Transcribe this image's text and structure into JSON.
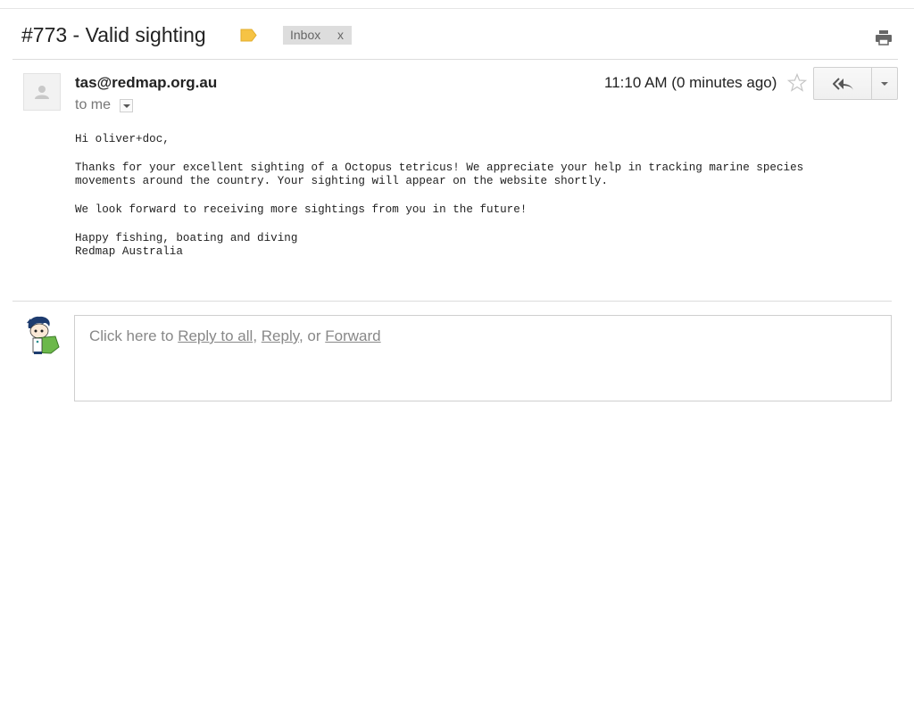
{
  "thread": {
    "subject": "#773 - Valid sighting",
    "label_icon": "label-tag-icon",
    "label_color": "#f6c344",
    "inbox_chip": {
      "label": "Inbox",
      "remove": "x"
    },
    "print_icon": "print-icon"
  },
  "message": {
    "sender": "tas@redmap.org.au",
    "recipient_label": "to me",
    "timestamp": "11:10 AM (0 minutes ago)",
    "star_icon": "star-outline-icon",
    "reply_icon": "reply-all-icon",
    "more_icon": "chevron-down-icon",
    "body": [
      "Hi oliver+doc,",
      "Thanks for your excellent sighting of a Octopus tetricus! We appreciate your help in tracking marine species\nmovements around the country. Your sighting will appear on the website shortly.",
      "We look forward to receiving more sightings from you in the future!",
      "Happy fishing, boating and diving\nRedmap Australia"
    ]
  },
  "reply_box": {
    "prefix": "Click here to ",
    "reply_all": "Reply to all",
    "sep1": ", ",
    "reply": "Reply",
    "sep2": ", or ",
    "forward": "Forward"
  }
}
